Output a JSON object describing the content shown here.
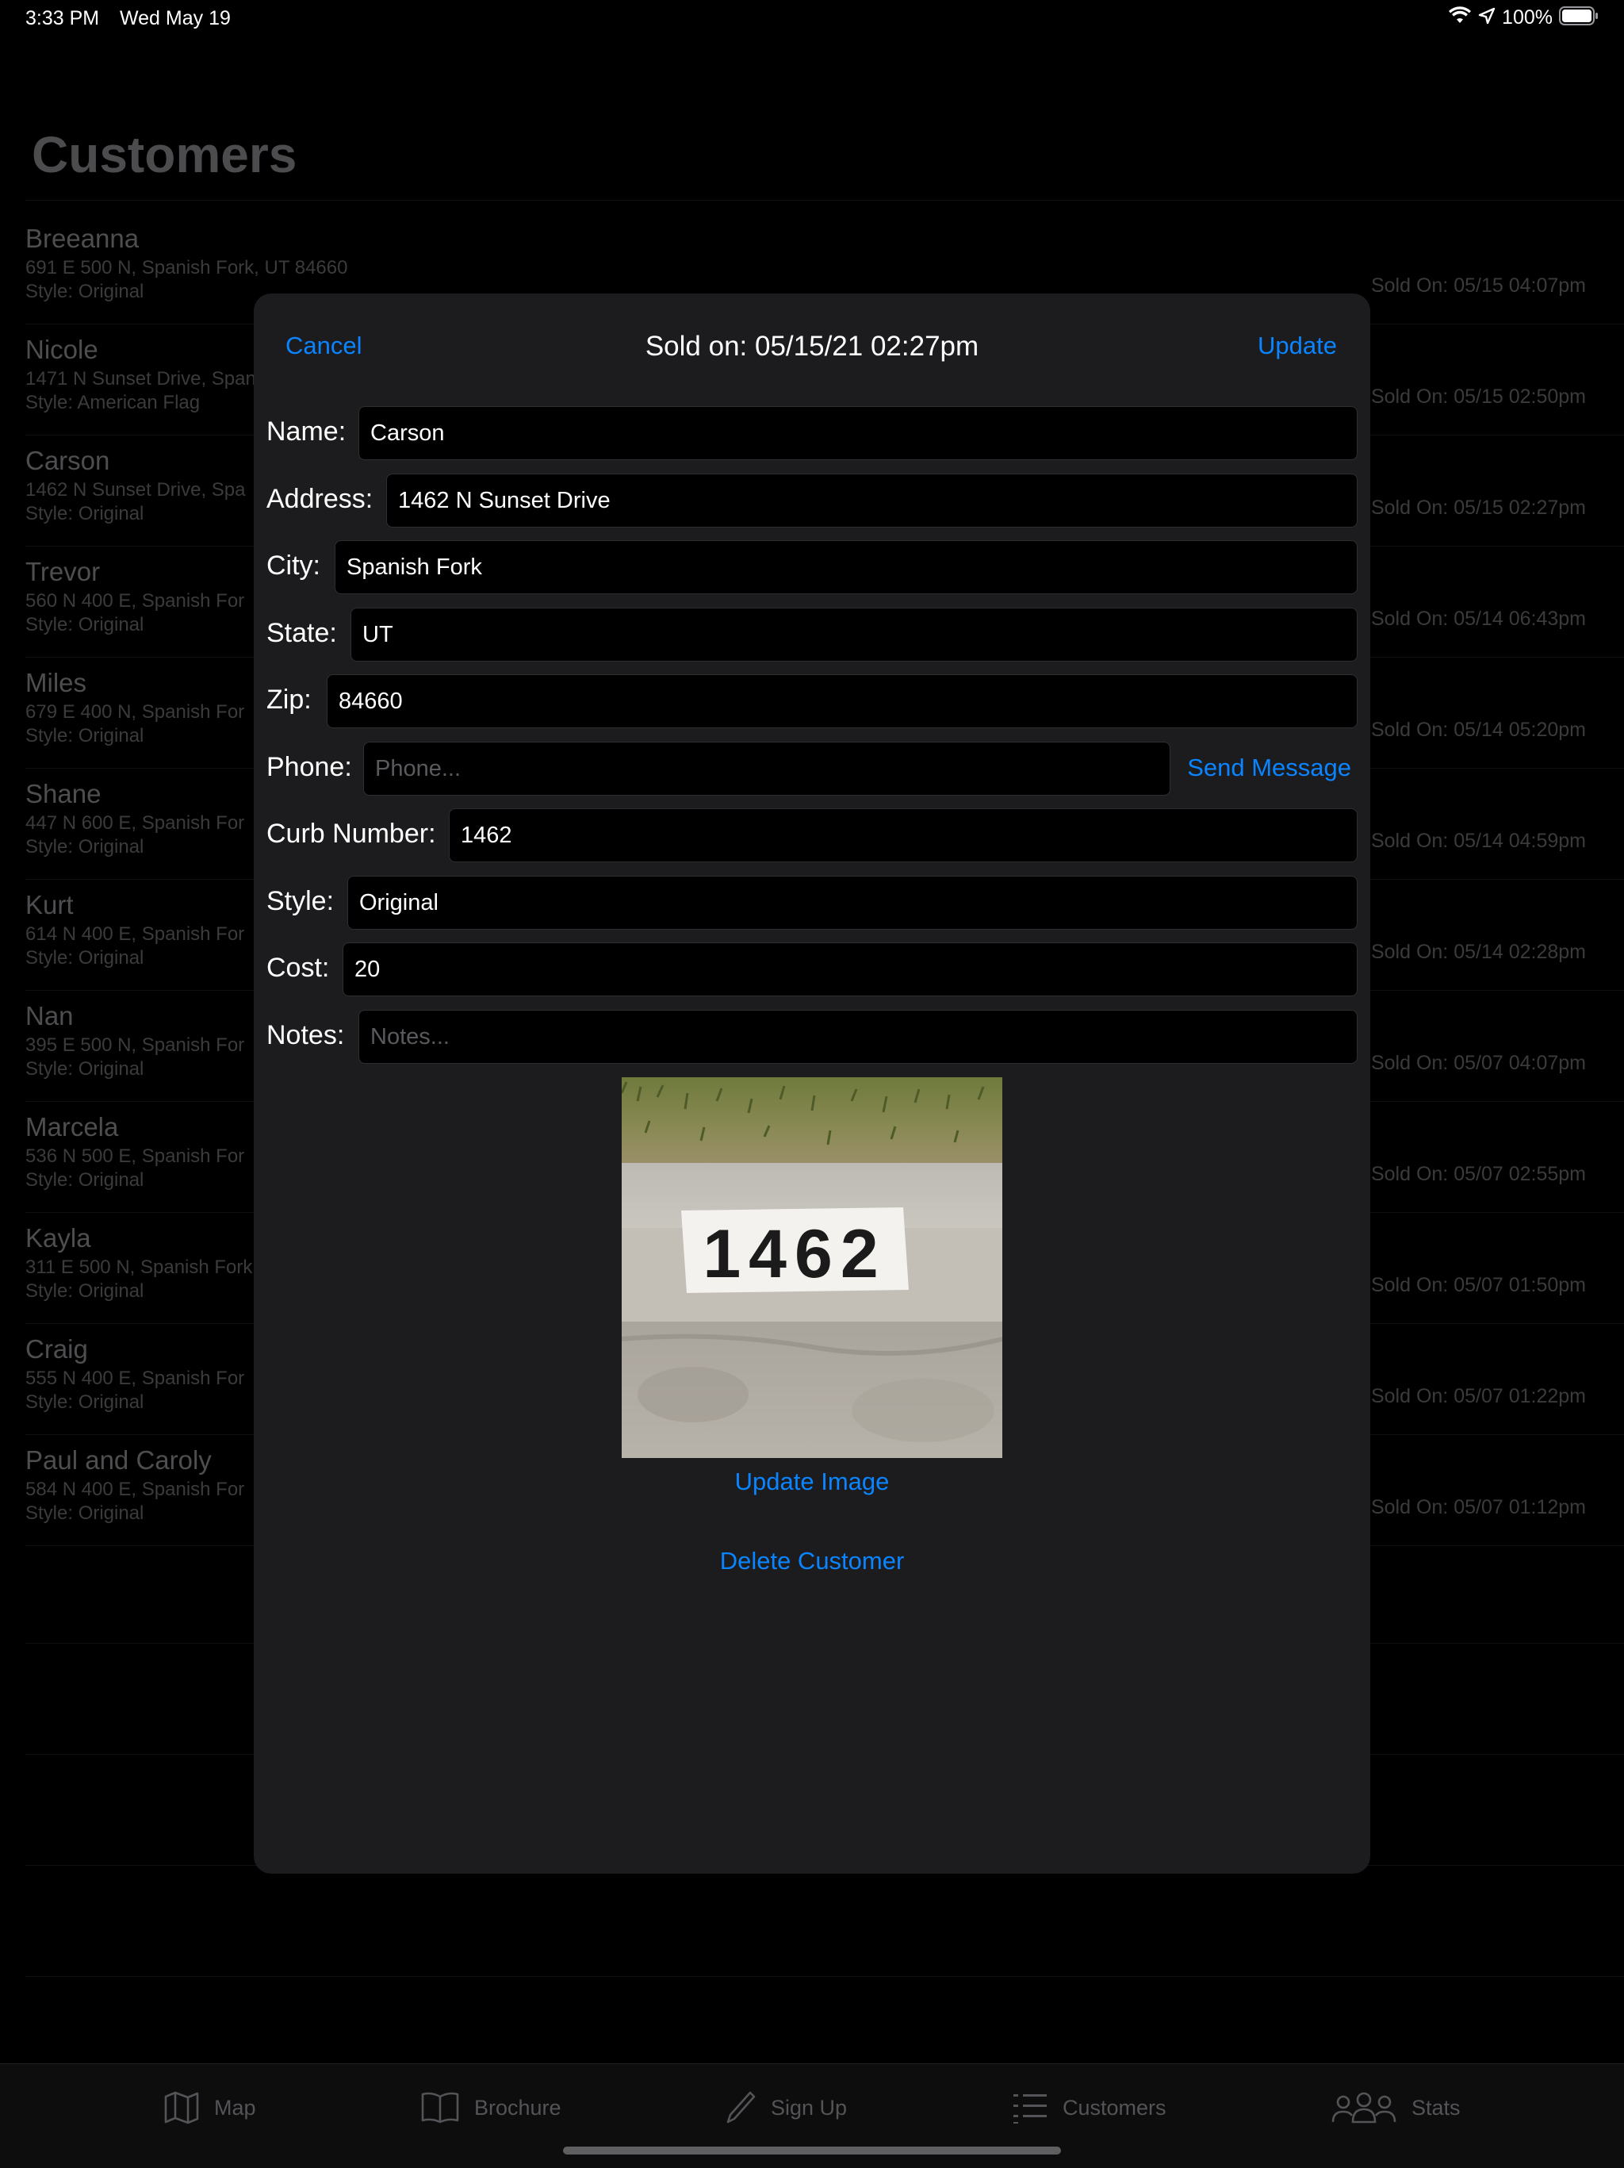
{
  "status_bar": {
    "time": "3:33 PM",
    "date": "Wed May 19",
    "battery": "100%",
    "icons": [
      "wifi-icon",
      "location-icon",
      "battery-icon"
    ]
  },
  "background": {
    "title": "Customers",
    "customers": [
      {
        "name": "Breeanna",
        "address": "691 E 500 N, Spanish Fork, UT 84660",
        "style": "Style: Original",
        "sold": "Sold On: 05/15 04:07pm"
      },
      {
        "name": "Nicole",
        "address": "1471 N Sunset Drive, Span",
        "style": "Style: American Flag",
        "sold": "Sold On: 05/15 02:50pm"
      },
      {
        "name": "Carson",
        "address": "1462 N Sunset Drive, Spa",
        "style": "Style: Original",
        "sold": "Sold On: 05/15 02:27pm"
      },
      {
        "name": "Trevor",
        "address": "560 N 400 E, Spanish For",
        "style": "Style: Original",
        "sold": "Sold On: 05/14 06:43pm"
      },
      {
        "name": "Miles",
        "address": "679 E 400 N, Spanish For",
        "style": "Style: Original",
        "sold": "Sold On: 05/14 05:20pm"
      },
      {
        "name": "Shane",
        "address": "447 N 600 E, Spanish For",
        "style": "Style: Original",
        "sold": "Sold On: 05/14 04:59pm"
      },
      {
        "name": "Kurt",
        "address": "614 N 400 E, Spanish For",
        "style": "Style: Original",
        "sold": "Sold On: 05/14 02:28pm"
      },
      {
        "name": "Nan",
        "address": "395 E 500 N, Spanish For",
        "style": "Style: Original",
        "sold": "Sold On: 05/07 04:07pm"
      },
      {
        "name": "Marcela",
        "address": "536 N 500 E, Spanish For",
        "style": "Style: Original",
        "sold": "Sold On: 05/07 02:55pm"
      },
      {
        "name": "Kayla",
        "address": "311 E 500 N, Spanish Fork",
        "style": "Style: Original",
        "sold": "Sold On: 05/07 01:50pm"
      },
      {
        "name": "Craig",
        "address": "555 N 400 E, Spanish For",
        "style": "Style: Original",
        "sold": "Sold On: 05/07 01:22pm"
      },
      {
        "name": "Paul and Caroly",
        "address": "584 N 400 E, Spanish For",
        "style": "Style: Original",
        "sold": "Sold On: 05/07 01:12pm"
      }
    ]
  },
  "modal": {
    "cancel": "Cancel",
    "title": "Sold on: 05/15/21 02:27pm",
    "update": "Update",
    "fields": {
      "name": {
        "label": "Name:",
        "value": "Carson"
      },
      "address": {
        "label": "Address:",
        "value": "1462 N Sunset Drive"
      },
      "city": {
        "label": "City:",
        "value": "Spanish Fork"
      },
      "state": {
        "label": "State:",
        "value": "UT"
      },
      "zip": {
        "label": "Zip:",
        "value": "84660"
      },
      "phone": {
        "label": "Phone:",
        "value": "",
        "placeholder": "Phone..."
      },
      "curb": {
        "label": "Curb Number:",
        "value": "1462"
      },
      "style": {
        "label": "Style:",
        "value": "Original"
      },
      "cost": {
        "label": "Cost:",
        "value": "20"
      },
      "notes": {
        "label": "Notes:",
        "value": "",
        "placeholder": "Notes..."
      }
    },
    "send_message": "Send Message",
    "photo_number": "1462",
    "update_image": "Update Image",
    "delete_customer": "Delete Customer"
  },
  "tab_bar": {
    "tabs": [
      {
        "label": "Map",
        "icon": "map-icon"
      },
      {
        "label": "Brochure",
        "icon": "book-icon"
      },
      {
        "label": "Sign Up",
        "icon": "pencil-icon"
      },
      {
        "label": "Customers",
        "icon": "list-icon"
      },
      {
        "label": "Stats",
        "icon": "people-icon"
      }
    ]
  },
  "colors": {
    "accent": "#0a84ff",
    "modal_bg": "#1c1c1e",
    "field_bg": "#000000"
  }
}
